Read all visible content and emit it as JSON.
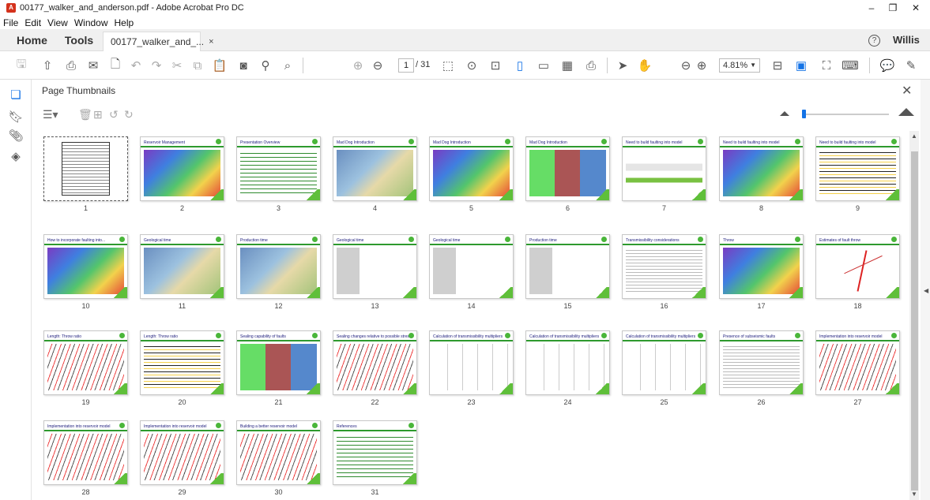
{
  "window": {
    "title": "00177_walker_and_anderson.pdf - Adobe Acrobat Pro DC",
    "minimize": "–",
    "restore": "❐",
    "close": "✕"
  },
  "menu": [
    "File",
    "Edit",
    "View",
    "Window",
    "Help"
  ],
  "nav": {
    "home": "Home",
    "tools": "Tools",
    "doc_tab": "00177_walker_and_...",
    "doc_tab_close": "×",
    "help": "?",
    "user": "Willis"
  },
  "toolbar": {
    "current_page": "1",
    "total_pages": "/ 31",
    "zoom": "4.81%"
  },
  "panel": {
    "title": "Page Thumbnails",
    "close": "✕"
  },
  "thumbnails": [
    {
      "label": "1",
      "title": "",
      "style": "slide1"
    },
    {
      "label": "2",
      "title": "Reservoir Management",
      "style": "color"
    },
    {
      "label": "3",
      "title": "Presentation Overview",
      "style": "textgreen"
    },
    {
      "label": "4",
      "title": "Mad Dog Introduction",
      "style": "map"
    },
    {
      "label": "5",
      "title": "Mad Dog Introduction",
      "style": "color"
    },
    {
      "label": "6",
      "title": "Mad Dog Introduction",
      "style": "multi"
    },
    {
      "label": "7",
      "title": "Need to build faulting into model",
      "style": "flow"
    },
    {
      "label": "8",
      "title": "Need to build faulting into model",
      "style": "color"
    },
    {
      "label": "9",
      "title": "Need to build faulting into model",
      "style": "strata"
    },
    {
      "label": "10",
      "title": "How to incorporate faulting into...",
      "style": "color"
    },
    {
      "label": "11",
      "title": "Geological time",
      "style": "map"
    },
    {
      "label": "12",
      "title": "Production time",
      "style": "map"
    },
    {
      "label": "13",
      "title": "Geological time",
      "style": "grey"
    },
    {
      "label": "14",
      "title": "Geological time",
      "style": "grey"
    },
    {
      "label": "15",
      "title": "Production time",
      "style": "grey"
    },
    {
      "label": "16",
      "title": "Transmissibility considerations",
      "style": "text"
    },
    {
      "label": "17",
      "title": "Throw",
      "style": "color"
    },
    {
      "label": "18",
      "title": "Estimates of fault throw",
      "style": "fault"
    },
    {
      "label": "19",
      "title": "Length: Throw ratio",
      "style": "redlines"
    },
    {
      "label": "20",
      "title": "Length: Throw ratio",
      "style": "strata"
    },
    {
      "label": "21",
      "title": "Sealing capability of faults",
      "style": "multi"
    },
    {
      "label": "22",
      "title": "Sealing changes relative to possible stress",
      "style": "redlines"
    },
    {
      "label": "23",
      "title": "Calculation of transmissibility multipliers",
      "style": "grid"
    },
    {
      "label": "24",
      "title": "Calculation of transmissibility multipliers",
      "style": "grid"
    },
    {
      "label": "25",
      "title": "Calculation of transmissibility multipliers",
      "style": "grid"
    },
    {
      "label": "26",
      "title": "Presence of subseismic faults",
      "style": "text"
    },
    {
      "label": "27",
      "title": "Implementation into reservoir model",
      "style": "redlines"
    },
    {
      "label": "28",
      "title": "Implementation into reservoir model",
      "style": "redlines"
    },
    {
      "label": "29",
      "title": "Implementation into reservoir model",
      "style": "redlines"
    },
    {
      "label": "30",
      "title": "Building a better reservoir model",
      "style": "redlines"
    },
    {
      "label": "31",
      "title": "References",
      "style": "textgreen"
    }
  ],
  "colors": {
    "accent_blue": "#1473e6",
    "slide_green": "#2e9a2e",
    "toolbar_grey": "#555555"
  }
}
